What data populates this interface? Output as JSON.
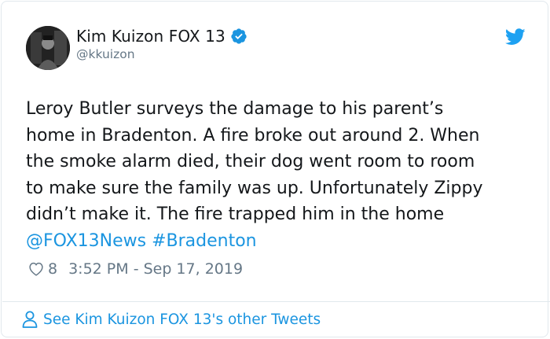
{
  "author": {
    "display_name": "Kim Kuizon FOX 13",
    "handle": "@kkuizon",
    "verified": true
  },
  "tweet": {
    "lines": [
      "Leroy Butler surveys the damage to his parent’s",
      "home in Bradenton. A fire broke out around 2. When",
      "the smoke alarm died, their dog went room to room",
      "to make sure the family was up. Unfortunately Zippy",
      "didn’t make it. The fire trapped him in the home"
    ],
    "mention": "@FOX13News",
    "hashtag": "#Bradenton"
  },
  "meta": {
    "likes": "8",
    "timestamp": "3:52 PM - Sep 17, 2019"
  },
  "footer": {
    "link_text": "See Kim Kuizon FOX 13's other Tweets"
  },
  "colors": {
    "link": "#1b95e0",
    "secondary": "#657786",
    "border": "#e1e8ed"
  },
  "icons": [
    "verified-badge-icon",
    "twitter-bird-icon",
    "heart-icon",
    "person-icon"
  ]
}
